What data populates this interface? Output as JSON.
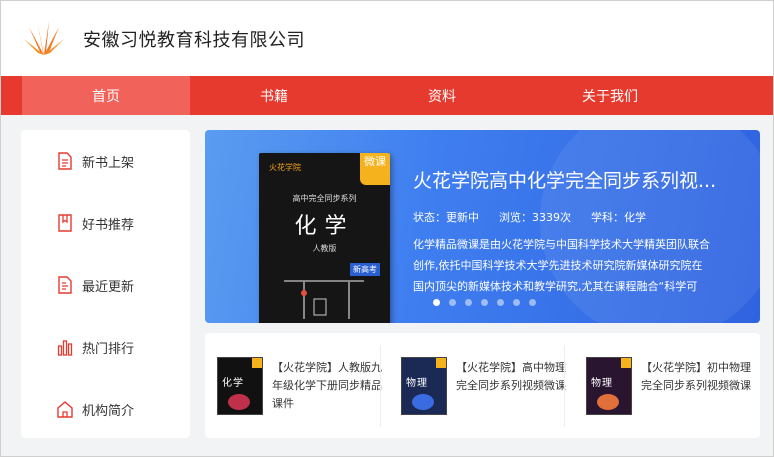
{
  "header": {
    "company_name": "安徽习悦教育科技有限公司"
  },
  "nav": {
    "items": [
      "首页",
      "书籍",
      "资料",
      "关于我们"
    ]
  },
  "sidebar": {
    "items": [
      {
        "label": "新书上架",
        "icon": "document-icon"
      },
      {
        "label": "好书推荐",
        "icon": "bookmark-icon"
      },
      {
        "label": "最近更新",
        "icon": "edit-icon"
      },
      {
        "label": "热门排行",
        "icon": "bar-chart-icon"
      },
      {
        "label": "机构简介",
        "icon": "building-icon"
      }
    ]
  },
  "banner": {
    "title": "火花学院高中化学完全同步系列视...",
    "status": "状态：更新中",
    "views": "浏览：3339次",
    "subject": "学科：化学",
    "description": "化学精品微课是由火花学院与中国科学技术大学精英团队联合创作,依托中国科学技术大学先进技术研究院新媒体研究院在国内顶尖的新媒体技术和教学研究,尤其在课程融合“科学可",
    "slide_count": 7,
    "active_slide": 0,
    "book": {
      "brand": "火花学院",
      "badge": "微课",
      "subtitle": "高中完全同步系列",
      "title": "化学",
      "publisher": "人教版",
      "tag": "新高考"
    }
  },
  "booklist": {
    "items": [
      {
        "title": "【火花学院】人教版九年级化学下册同步精品课件",
        "cover_title": "化学"
      },
      {
        "title": "【火花学院】高中物理完全同步系列视频微课",
        "cover_title": "物理"
      },
      {
        "title": "【火花学院】初中物理完全同步系列视频微课",
        "cover_title": "物理"
      }
    ]
  }
}
